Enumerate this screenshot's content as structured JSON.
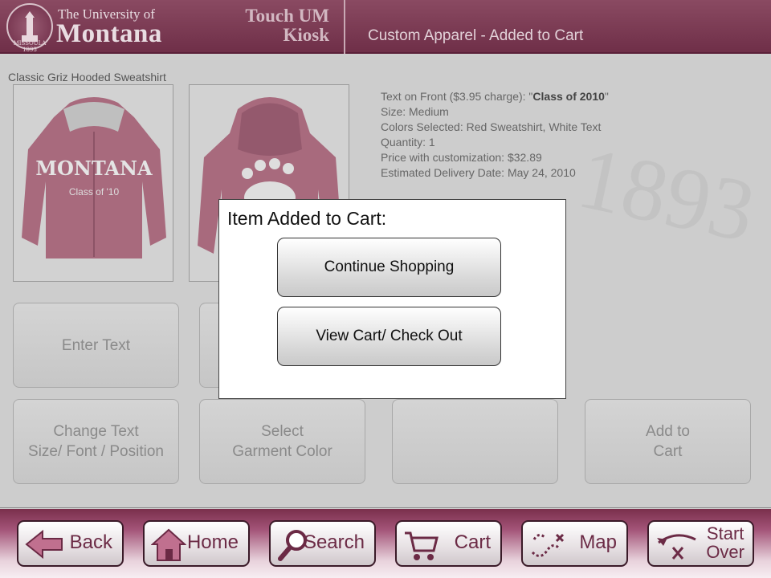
{
  "header": {
    "seal_text": "MISSOULA 1893",
    "univ_of": "The University of",
    "montana": "Montana",
    "kiosk_line1": "Touch UM",
    "kiosk_line2": "Kiosk",
    "page_heading": "Custom Apparel - Added to Cart"
  },
  "watermark": "1893",
  "product": {
    "title": "Classic Griz Hooded Sweatshirt",
    "front_overlay_text": "Class of '10",
    "front_print": "MONTANA"
  },
  "details": {
    "text_front_label": "Text on Front ($3.95 charge): \"",
    "text_front_value": "Class of 2010",
    "text_front_close": "\"",
    "size": "Size: Medium",
    "colors": "Colors Selected: Red Sweatshirt, White Text",
    "quantity": "Quantity: 1",
    "price": "Price with customization: $32.89",
    "delivery": "Estimated Delivery Date: May 24, 2010"
  },
  "options": {
    "enter_text": "Enter Text",
    "change_text_1": "Change Text",
    "change_text_2": "Size/ Font / Position",
    "garment_1": "Select",
    "garment_2": "Garment Color",
    "add_1": "Add to",
    "add_2": "Cart"
  },
  "modal": {
    "title": "Item Added to Cart:",
    "continue_label": "Continue Shopping",
    "viewcart_label": "View Cart/ Check Out"
  },
  "nav": {
    "back": "Back",
    "home": "Home",
    "search": "Search",
    "cart": "Cart",
    "map": "Map",
    "start": "Start",
    "over": "Over"
  },
  "colors": {
    "maroon": "#6f2f48",
    "nav_text": "#6b2a45"
  }
}
